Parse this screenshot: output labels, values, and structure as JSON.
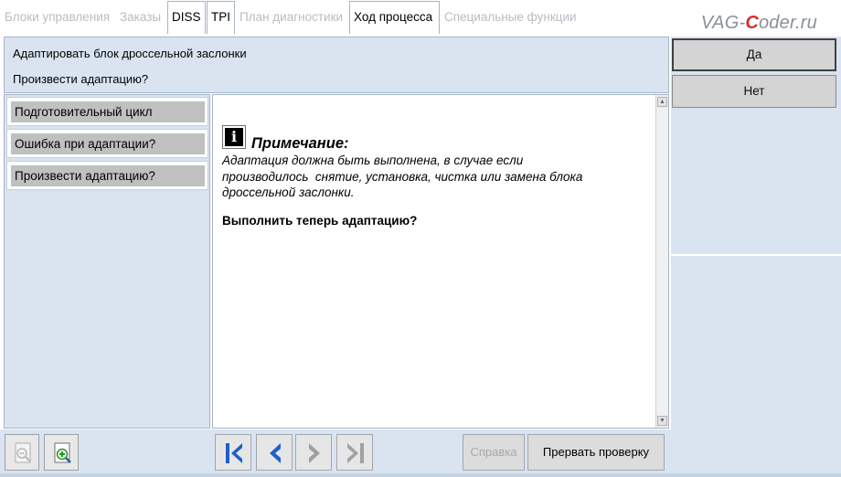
{
  "tabs": [
    {
      "label": "Блоки управления",
      "active": false
    },
    {
      "label": "Заказы",
      "active": false
    },
    {
      "label": "DISS",
      "active": true
    },
    {
      "label": "TPI",
      "active": true
    },
    {
      "label": "План диагностики",
      "active": false
    },
    {
      "label": "Ход процесса",
      "active": true
    },
    {
      "label": "Специальные функции",
      "active": false
    }
  ],
  "watermark": {
    "prefix": "VAG-",
    "highlight": "C",
    "suffix": "oder.ru"
  },
  "header": {
    "title": "Адаптировать блок дроссельной заслонки",
    "question": "Произвести адаптацию?"
  },
  "answers": {
    "yes": "Да",
    "no": "Нет"
  },
  "steps": [
    {
      "label": "Подготовительный цикл"
    },
    {
      "label": "Ошибка при адаптации?"
    },
    {
      "label": "Произвести адаптацию?"
    }
  ],
  "content": {
    "note_title": "Примечание:",
    "note_text": "Адаптация должна быть выполнена, в случае если\nпроизводилось  снятие, установка, чистка или замена блока\nдроссельной заслонки.",
    "question": "Выполнить теперь адаптацию?"
  },
  "toolbar": {
    "help_label": "Справка",
    "abort_label": "Прервать проверку"
  },
  "colors": {
    "panel_bg": "#dae4f0",
    "nav_blue": "#1f5fc8",
    "nav_disabled": "#a0a0a0"
  },
  "icons": [
    "zoom-out-icon",
    "zoom-in-icon",
    "first-step-icon",
    "previous-step-icon",
    "next-step-icon",
    "last-step-icon",
    "info-icon"
  ]
}
